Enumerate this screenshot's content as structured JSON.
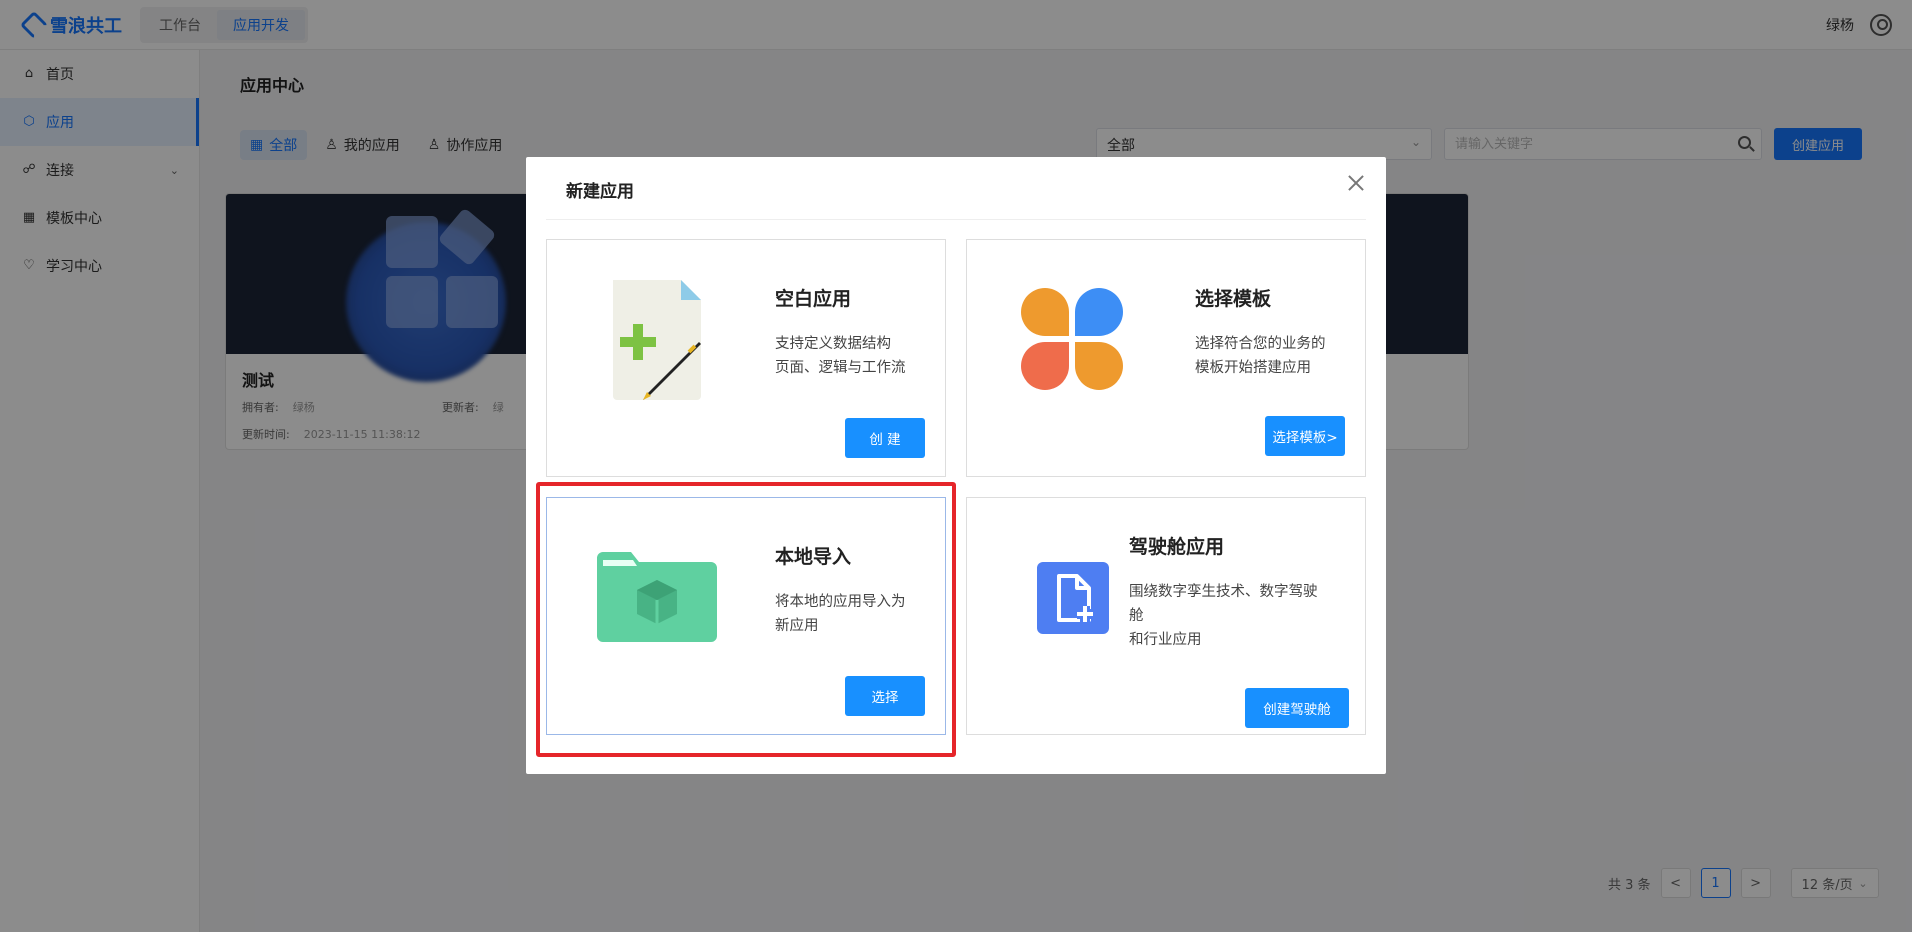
{
  "header": {
    "logo_text": "雪浪共工",
    "tabs": [
      {
        "label": "工作台",
        "active": false
      },
      {
        "label": "应用开发",
        "active": true
      }
    ],
    "username": "绿杨"
  },
  "sidebar": {
    "items": [
      {
        "label": "首页",
        "icon": "home-icon",
        "active": false
      },
      {
        "label": "应用",
        "icon": "cube-icon",
        "active": true
      },
      {
        "label": "连接",
        "icon": "link-icon",
        "active": false,
        "expandable": true
      },
      {
        "label": "模板中心",
        "icon": "grid-icon",
        "active": false
      },
      {
        "label": "学习中心",
        "icon": "bulb-icon",
        "active": false
      }
    ]
  },
  "main": {
    "title": "应用中心",
    "filter_tabs": [
      {
        "label": "全部",
        "icon": "grid-icon",
        "active": true
      },
      {
        "label": "我的应用",
        "icon": "user-icon",
        "active": false
      },
      {
        "label": "协作应用",
        "icon": "users-icon",
        "active": false
      }
    ],
    "select_value": "全部",
    "search_placeholder": "请输入关键字",
    "create_label": "创建应用",
    "app_card": {
      "name": "测试",
      "owner_label": "拥有者:",
      "owner_value": "绿杨",
      "updater_label": "更新者:",
      "updater_value": "绿",
      "updated_label": "更新时间:",
      "updated_value": "2023-11-15 11:38:12"
    },
    "pagination": {
      "total": "共 3 条",
      "prev": "<",
      "current": "1",
      "next": ">",
      "page_size": "12 条/页"
    }
  },
  "modal": {
    "title": "新建应用",
    "options": [
      {
        "title": "空白应用",
        "desc_lines": [
          "支持定义数据结构",
          "页面、逻辑与工作流"
        ],
        "button": "创 建"
      },
      {
        "title": "选择模板",
        "desc_lines": [
          "选择符合您的业务的",
          "模板开始搭建应用"
        ],
        "button": "选择模板>"
      },
      {
        "title": "本地导入",
        "desc_lines": [
          "将本地的应用导入为",
          "新应用"
        ],
        "button": "选择"
      },
      {
        "title": "驾驶舱应用",
        "desc_lines": [
          "围绕数字孪生技术、数字驾驶",
          "舱",
          "和行业应用"
        ],
        "button": "创建驾驶舱"
      }
    ]
  },
  "colors": {
    "accent": "#1677ff",
    "highlight": "#e5252a"
  }
}
